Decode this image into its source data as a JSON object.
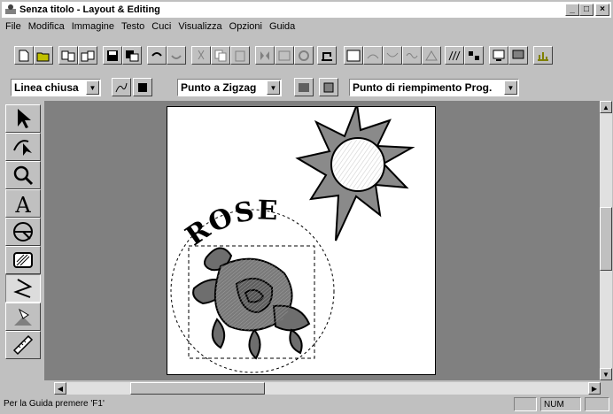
{
  "window": {
    "title": "Senza titolo - Layout & Editing",
    "minimize_label": "_",
    "restore_label": "□",
    "close_label": "×"
  },
  "menu": [
    "File",
    "Modifica",
    "Immagine",
    "Testo",
    "Cuci",
    "Visualizza",
    "Opzioni",
    "Guida"
  ],
  "toolbar2": {
    "line_type": "Linea chiusa",
    "outline_stitch": "Punto a Zigzag",
    "fill_stitch": "Punto di riempimento Prog."
  },
  "canvas": {
    "text_object": "ROSE"
  },
  "status": {
    "message": "Per la Guida premere 'F1'",
    "num_indicator": "NUM"
  },
  "colors": {
    "titlebar_bg": "#ffffff",
    "workspace_bg": "#808080",
    "sun_fill": "#8a8a8a",
    "rose_fill": "#6e6e6e"
  }
}
